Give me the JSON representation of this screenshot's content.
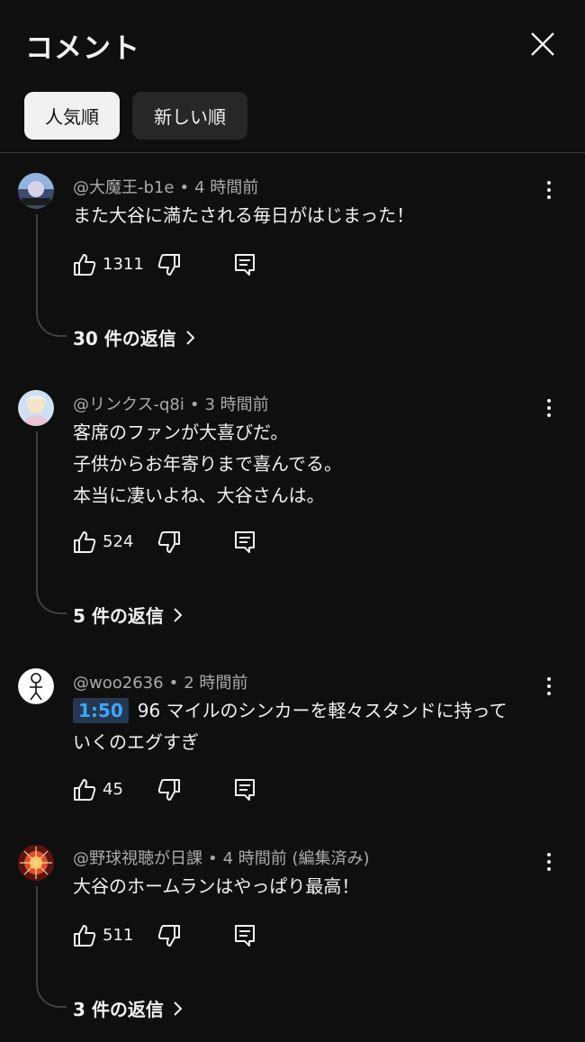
{
  "header": {
    "title": "コメント",
    "chips": [
      "人気順",
      "新しい順"
    ]
  },
  "comments": [
    {
      "author": "@大魔王-b1e",
      "time": "4 時間前",
      "lines": [
        "また大谷に満たされる毎日がはじまった！"
      ],
      "likes": "1311",
      "replies": "30 件の返信"
    },
    {
      "author": "@リンクス-q8i",
      "time": "3 時間前",
      "lines": [
        "客席のファンが大喜びだ。",
        "子供からお年寄りまで喜んでる。",
        "本当に凄いよね、大谷さんは。"
      ],
      "likes": "524",
      "replies": "5 件の返信"
    },
    {
      "author": "@woo2636",
      "time": "2 時間前",
      "timestamp_link": "1:50",
      "lines": [
        "96 マイルのシンカーを軽々スタンドに持って",
        "いくのエグすぎ"
      ],
      "likes": "45"
    },
    {
      "author": "@野球視聴が日課",
      "time": "4 時間前 (編集済み)",
      "lines": [
        "大谷のホームランはやっぱり最高！"
      ],
      "likes": "511",
      "replies": "3 件の返信"
    }
  ],
  "colors": {
    "background": "#0f0f0f",
    "text": "#f1f1f1",
    "secondary_text": "#aaaaaa",
    "chip_active_bg": "#f1f1f1",
    "chip_inactive_bg": "#272727",
    "link": "#3ea6ff"
  },
  "icons": [
    "close-icon",
    "like-icon",
    "dislike-icon",
    "reply-icon",
    "more-vert-icon",
    "chevron-right-icon"
  ]
}
